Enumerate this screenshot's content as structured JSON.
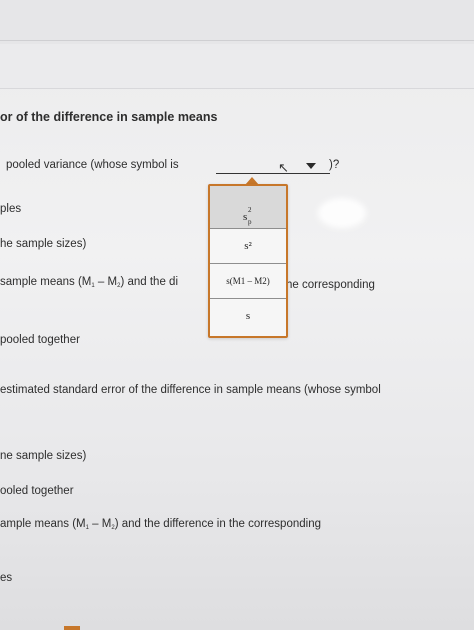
{
  "heading": "or of the difference in sample means",
  "lines": {
    "l1_prefix": "pooled variance (whose symbol is",
    "l1_suffix": ")?",
    "l2": "ples",
    "l3": "he sample sizes)",
    "l4_prefix": "sample means (M",
    "l4_sub1": "1",
    "l4_mid": " – M",
    "l4_sub2": "2",
    "l4_suffix": ") and the di",
    "l4_after": "he corresponding",
    "l5": "pooled together",
    "l6": "estimated standard error of the difference in sample means (whose symbol",
    "l7": "ne sample sizes)",
    "l8": "ooled together",
    "l9_prefix": "ample means (M",
    "l9_sub1": "1",
    "l9_mid": " – M",
    "l9_sub2": "2",
    "l9_suffix": ") and the difference in the corresponding",
    "l10": "es"
  },
  "dropdown": {
    "opt1_base": "s",
    "opt1_sup": "2",
    "opt1_sub": "p",
    "opt2": "s²",
    "opt3": "s(M1 – M2)",
    "opt4": "s"
  },
  "colors": {
    "accent": "#c7772a",
    "text": "#2e2e2e"
  },
  "icons": [
    "chevron-down-icon",
    "cursor-icon"
  ]
}
